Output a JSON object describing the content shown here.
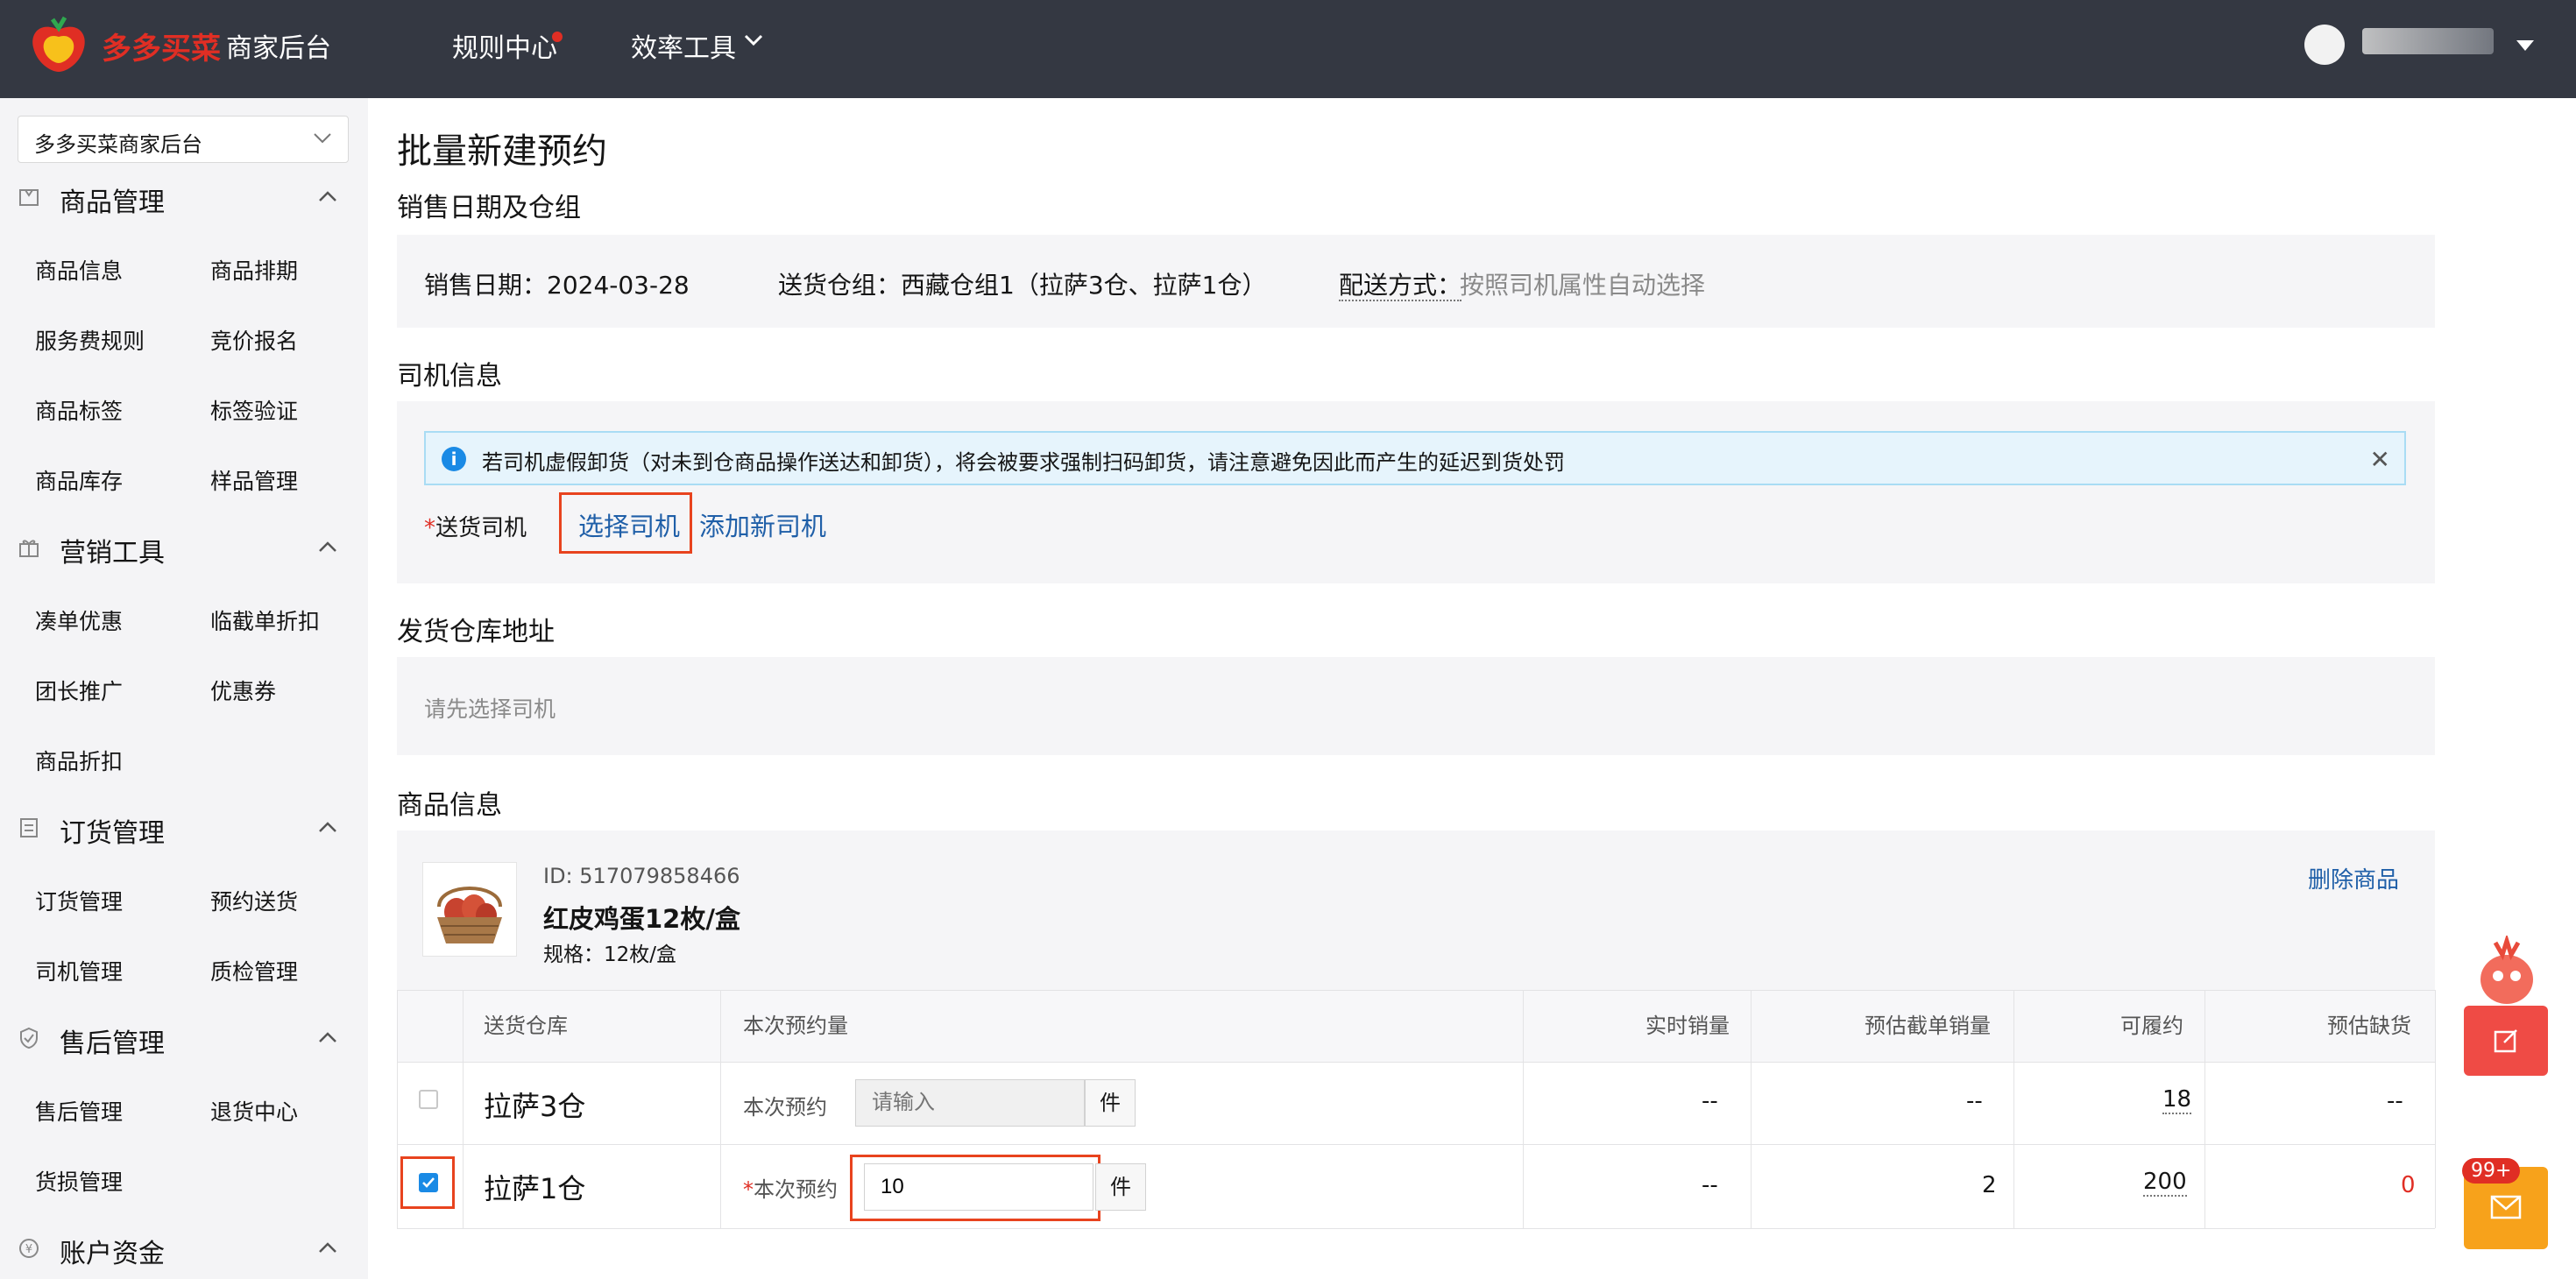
{
  "header": {
    "logo_text": "多多买菜",
    "logo_sub": "商家后台",
    "nav": [
      {
        "label": "规则中心"
      },
      {
        "label": "效率工具"
      }
    ]
  },
  "sidebar": {
    "store_select": "多多买菜商家后台",
    "sections": [
      {
        "title": "商品管理",
        "icon": "box-icon",
        "items": [
          "商品信息",
          "商品排期",
          "服务费规则",
          "竞价报名",
          "商品标签",
          "标签验证",
          "商品库存",
          "样品管理"
        ]
      },
      {
        "title": "营销工具",
        "icon": "gift-icon",
        "items": [
          "凑单优惠",
          "临截单折扣",
          "团长推广",
          "优惠券",
          "商品折扣"
        ]
      },
      {
        "title": "订货管理",
        "icon": "list-icon",
        "items": [
          "订货管理",
          "预约送货",
          "司机管理",
          "质检管理"
        ]
      },
      {
        "title": "售后管理",
        "icon": "shield-icon",
        "items": [
          "售后管理",
          "退货中心",
          "货损管理"
        ]
      },
      {
        "title": "账户资金",
        "icon": "yen-icon",
        "items": []
      }
    ]
  },
  "page": {
    "title": "批量新建预约",
    "sales_section": "销售日期及仓组",
    "sales_date": "销售日期：2024-03-28",
    "warehouse_group": "送货仓组：西藏仓组1（拉萨3仓、拉萨1仓）",
    "delivery_label": "配送方式：",
    "delivery_value": "按照司机属性自动选择",
    "driver_section": "司机信息",
    "alert_text": "若司机虚假卸货（对未到仓商品操作送达和卸货），将会被要求强制扫码卸货，请注意避免因此而产生的延迟到货处罚",
    "driver_label": "送货司机",
    "select_driver": "选择司机",
    "add_driver": "添加新司机",
    "warehouse_address_section": "发货仓库地址",
    "warehouse_address_placeholder": "请先选择司机",
    "product_section": "商品信息",
    "product": {
      "id": "ID: 517079858466",
      "name": "红皮鸡蛋12枚/盒",
      "spec": "规格：12枚/盒",
      "delete": "删除商品"
    },
    "table": {
      "headers": [
        "送货仓库",
        "本次预约量",
        "实时销量",
        "预估截单销量",
        "可履约",
        "预估缺货"
      ],
      "rows": [
        {
          "checked": false,
          "warehouse": "拉萨3仓",
          "appt_label": "本次预约",
          "input_value": "",
          "placeholder": "请输入",
          "unit": "件",
          "realtime": "--",
          "forecast": "--",
          "available": "18",
          "shortage": "--"
        },
        {
          "checked": true,
          "warehouse": "拉萨1仓",
          "appt_label": "本次预约",
          "input_value": "10",
          "placeholder": "",
          "unit": "件",
          "realtime": "--",
          "forecast": "2",
          "available": "200",
          "shortage": "0"
        }
      ]
    }
  },
  "float": {
    "badge": "99+"
  },
  "colors": {
    "brand_red": "#e02e24",
    "link_blue": "#1f5fa8",
    "topbar": "#343842",
    "highlight": "#e8431e",
    "orange_btn": "#f7a21b"
  }
}
